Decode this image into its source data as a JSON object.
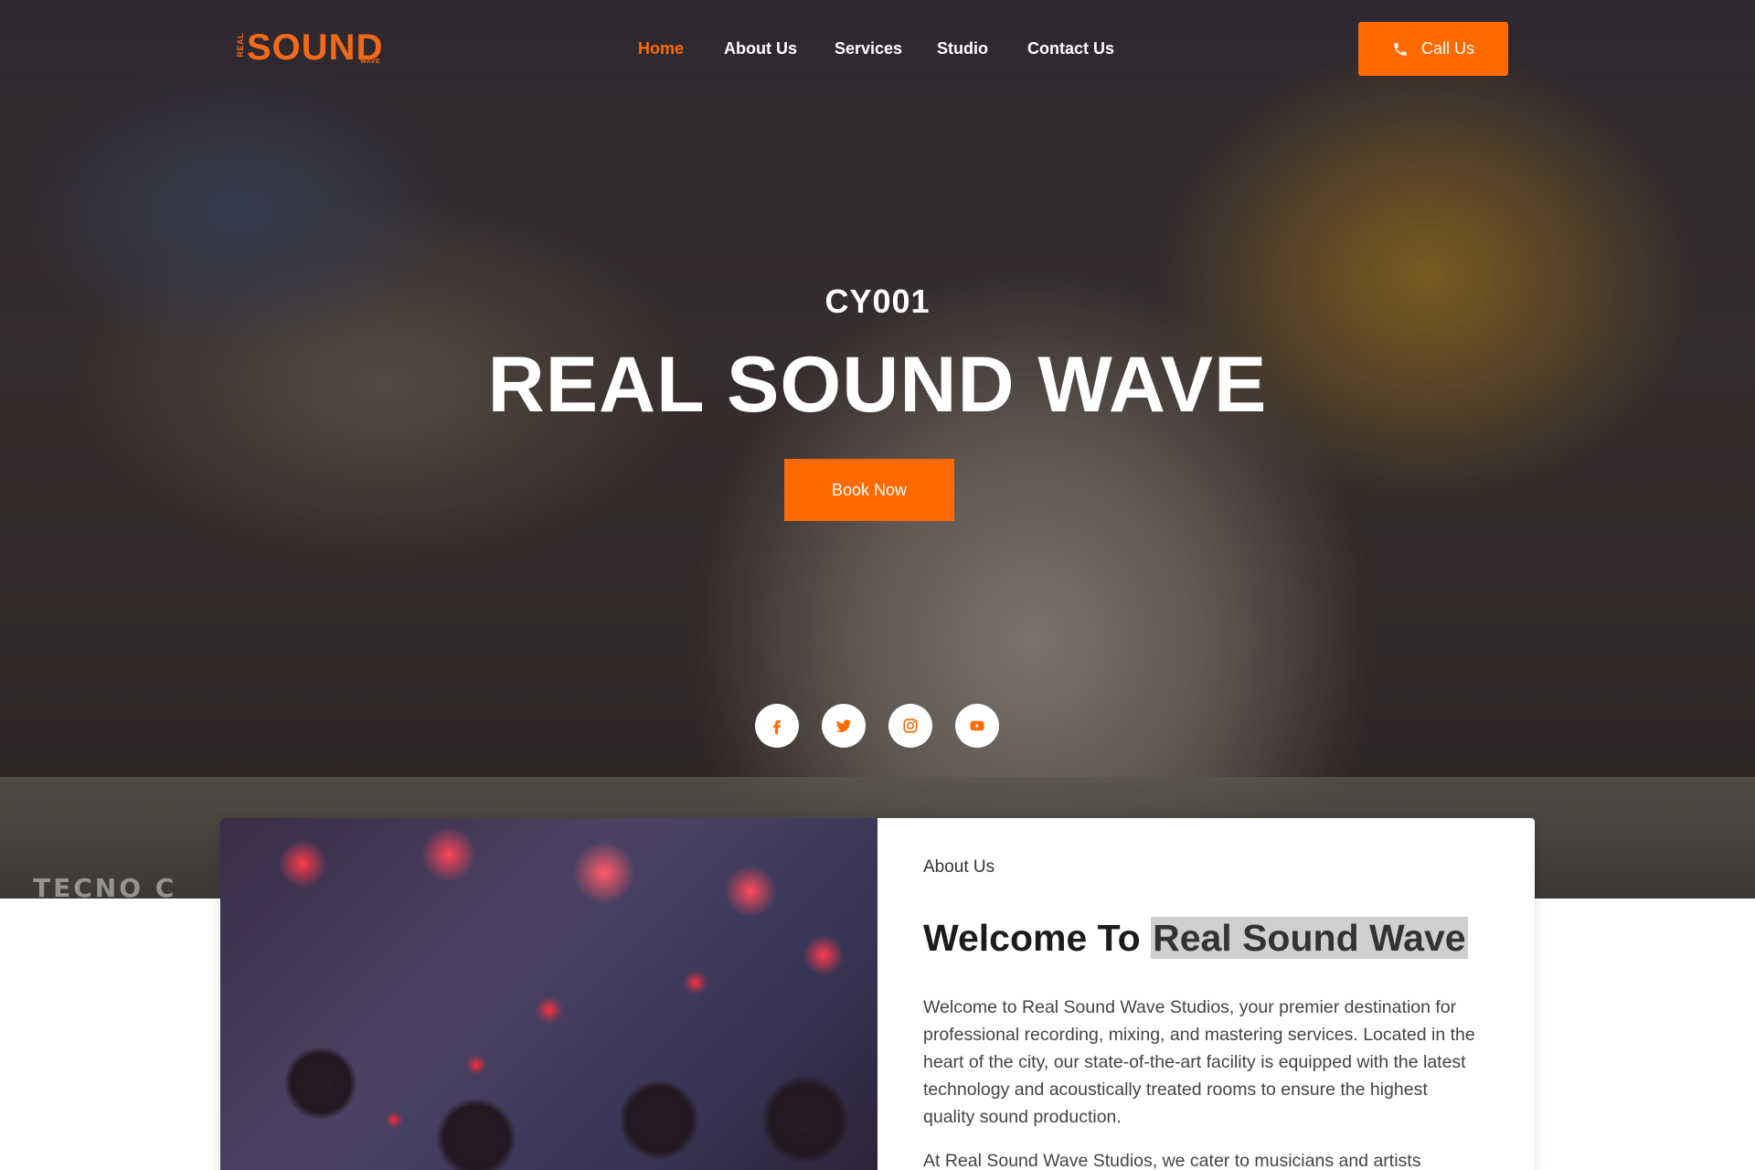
{
  "brand": {
    "logo_real": "REAL",
    "logo_sound": "SOUND",
    "logo_wave": "WAVE",
    "accent_color": "#ff6a00"
  },
  "nav": {
    "items": [
      {
        "label": "Home",
        "active": true
      },
      {
        "label": "About Us",
        "active": false
      },
      {
        "label": "Services",
        "active": false
      },
      {
        "label": "Studio",
        "active": false
      },
      {
        "label": "Contact Us",
        "active": false
      }
    ],
    "call_label": "Call Us",
    "call_icon": "phone-icon"
  },
  "hero": {
    "subtitle": "CY001",
    "title": "REAL SOUND WAVE",
    "cta_label": "Book Now",
    "watermark": "TECNO C",
    "socials": [
      "facebook-icon",
      "twitter-icon",
      "instagram-icon",
      "youtube-icon"
    ]
  },
  "about": {
    "label": "About Us",
    "heading_prefix": "Welcome To ",
    "heading_highlight": "Real Sound Wave",
    "paragraph_1": "Welcome to Real Sound Wave Studios, your premier destination for professional recording, mixing, and mastering services. Located in the heart of the city, our state-of-the-art facility is equipped with the latest technology and acoustically treated rooms to ensure the highest quality sound production.",
    "paragraph_2": "At Real Sound Wave Studios, we cater to musicians and artists"
  }
}
